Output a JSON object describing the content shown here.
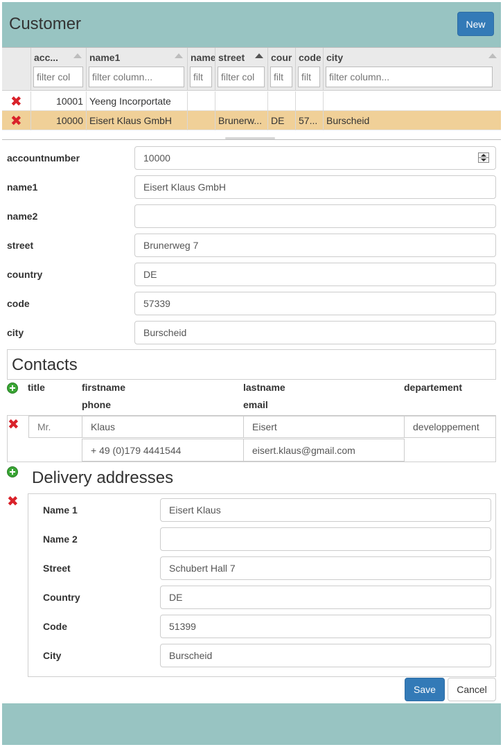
{
  "header": {
    "title": "Customer",
    "new_label": "New"
  },
  "grid": {
    "columns": [
      {
        "key": "accountnumber",
        "label": "acc...",
        "filter_placeholder": "filter col"
      },
      {
        "key": "name1",
        "label": "name1",
        "filter_placeholder": "filter column..."
      },
      {
        "key": "name2",
        "label": "name",
        "filter_placeholder": "filt"
      },
      {
        "key": "street",
        "label": "street",
        "filter_placeholder": "filter col"
      },
      {
        "key": "country",
        "label": "cour",
        "filter_placeholder": "filt"
      },
      {
        "key": "code",
        "label": "code",
        "filter_placeholder": "filt"
      },
      {
        "key": "city",
        "label": "city",
        "filter_placeholder": "filter column..."
      }
    ],
    "rows": [
      {
        "accountnumber": "10001",
        "name1": "Yeeng Incorportate",
        "name2": "",
        "street": "",
        "country": "",
        "code": "",
        "city": ""
      },
      {
        "accountnumber": "10000",
        "name1": "Eisert Klaus GmbH",
        "name2": "",
        "street": "Brunerw...",
        "country": "DE",
        "code": "57...",
        "city": "Burscheid"
      }
    ]
  },
  "form": {
    "accountnumber": {
      "label": "accountnumber",
      "value": "10000"
    },
    "name1": {
      "label": "name1",
      "value": "Eisert Klaus GmbH"
    },
    "name2": {
      "label": "name2",
      "value": ""
    },
    "street": {
      "label": "street",
      "value": "Brunerweg 7"
    },
    "country": {
      "label": "country",
      "value": "DE"
    },
    "code": {
      "label": "code",
      "value": "57339"
    },
    "city": {
      "label": "city",
      "value": "Burscheid"
    }
  },
  "contacts": {
    "title": "Contacts",
    "headers": {
      "title": "title",
      "firstname": "firstname",
      "lastname": "lastname",
      "departement": "departement",
      "phone": "phone",
      "email": "email"
    },
    "items": [
      {
        "title": "Mr.",
        "firstname": "Klaus",
        "lastname": "Eisert",
        "departement": "developpement",
        "phone": "+ 49 (0)179 4441544",
        "email": "eisert.klaus@gmail.com"
      }
    ]
  },
  "delivery": {
    "title": "Delivery addresses",
    "labels": {
      "name1": "Name 1",
      "name2": "Name 2",
      "street": "Street",
      "country": "Country",
      "code": "Code",
      "city": "City"
    },
    "items": [
      {
        "name1": "Eisert Klaus",
        "name2": "",
        "street": "Schubert Hall 7",
        "country": "DE",
        "code": "51399",
        "city": "Burscheid"
      }
    ]
  },
  "actions": {
    "save_label": "Save",
    "cancel_label": "Cancel"
  },
  "icons": {
    "delete": "delete-x-icon",
    "add": "add-circle-icon",
    "sort": "sort-caret-icon",
    "spinner": "number-spinner-icon"
  },
  "colors": {
    "background": "#98c4c2",
    "primary": "#337ab7",
    "selected_row": "#f0d098",
    "delete": "#d9222a",
    "add": "#3aa635"
  }
}
